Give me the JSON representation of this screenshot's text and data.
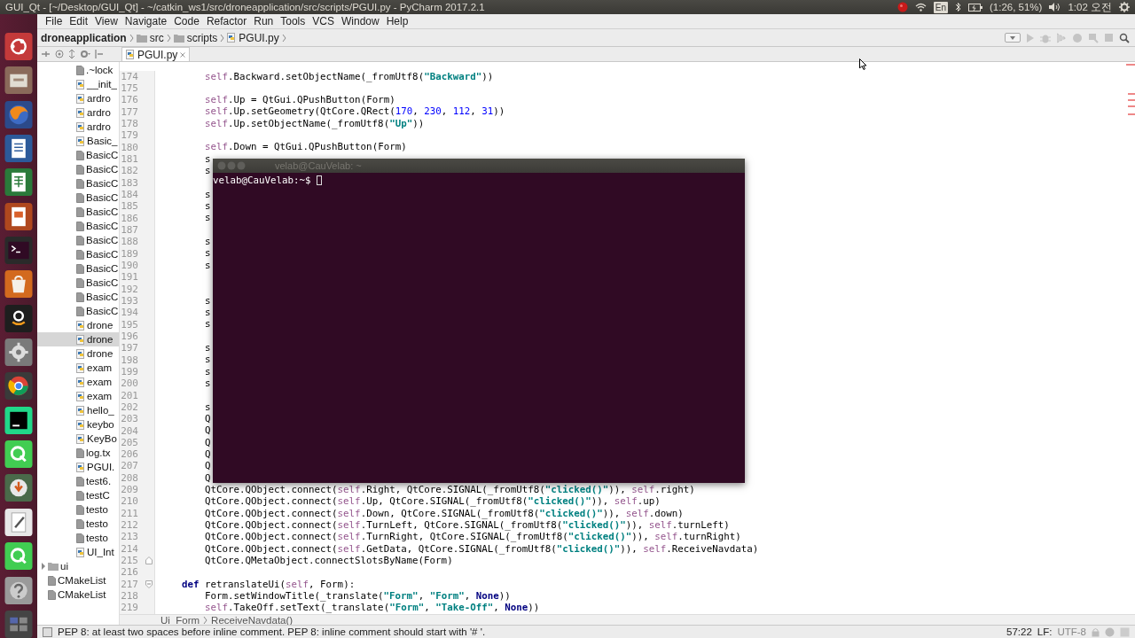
{
  "top_panel": {
    "window_title": "GUI_Qt - [~/Desktop/GUI_Qt] - ~/catkin_ws1/src/droneapplication/src/scripts/PGUI.py - PyCharm 2017.2.1",
    "keyboard": "En",
    "battery": "(1:26, 51%)",
    "clock": "1:02 오전"
  },
  "menu": [
    "File",
    "Edit",
    "View",
    "Navigate",
    "Code",
    "Refactor",
    "Run",
    "Tools",
    "VCS",
    "Window",
    "Help"
  ],
  "navigation_bar": [
    {
      "label": "droneapplication",
      "kind": "module"
    },
    {
      "label": "src",
      "kind": "folder"
    },
    {
      "label": "scripts",
      "kind": "folder"
    },
    {
      "label": "PGUI.py",
      "kind": "python"
    }
  ],
  "editor_tabs": [
    {
      "label": "PGUI.py",
      "selected": true
    }
  ],
  "project_tree": [
    {
      "kind": "group",
      "children": [
        {
          "label": ".~lock",
          "kind": "file",
          "selected": false
        },
        {
          "label": "__init_",
          "kind": "python",
          "selected": false
        },
        {
          "label": "ardro",
          "kind": "python",
          "selected": false
        },
        {
          "label": "ardro",
          "kind": "python",
          "selected": false
        },
        {
          "label": "ardro",
          "kind": "python",
          "selected": false
        },
        {
          "label": "Basic_",
          "kind": "python",
          "selected": false
        },
        {
          "label": "BasicC",
          "kind": "file",
          "selected": false
        },
        {
          "label": "BasicC",
          "kind": "file",
          "selected": false
        },
        {
          "label": "BasicC",
          "kind": "file",
          "selected": false
        },
        {
          "label": "BasicC",
          "kind": "file",
          "selected": false
        },
        {
          "label": "BasicC",
          "kind": "file",
          "selected": false
        },
        {
          "label": "BasicC",
          "kind": "file",
          "selected": false
        },
        {
          "label": "BasicC",
          "kind": "file",
          "selected": false
        },
        {
          "label": "BasicC",
          "kind": "file",
          "selected": false
        },
        {
          "label": "BasicC",
          "kind": "file",
          "selected": false
        },
        {
          "label": "BasicC",
          "kind": "file",
          "selected": false
        },
        {
          "label": "BasicC",
          "kind": "file",
          "selected": false
        },
        {
          "label": "BasicC",
          "kind": "file",
          "selected": false
        },
        {
          "label": "drone",
          "kind": "python",
          "selected": false
        },
        {
          "label": "drone",
          "kind": "python",
          "selected": true
        },
        {
          "label": "drone",
          "kind": "python",
          "selected": false
        },
        {
          "label": "exam",
          "kind": "python",
          "selected": false
        },
        {
          "label": "exam",
          "kind": "python",
          "selected": false
        },
        {
          "label": "exam",
          "kind": "python",
          "selected": false
        },
        {
          "label": "hello_",
          "kind": "python",
          "selected": false
        },
        {
          "label": "keybo",
          "kind": "python",
          "selected": false
        },
        {
          "label": "KeyBo",
          "kind": "python",
          "selected": false
        },
        {
          "label": "log.tx",
          "kind": "file",
          "selected": false
        },
        {
          "label": "PGUI.",
          "kind": "python",
          "selected": false
        },
        {
          "label": "test6.",
          "kind": "file",
          "selected": false
        },
        {
          "label": "testC",
          "kind": "file",
          "selected": false
        },
        {
          "label": "testo",
          "kind": "file",
          "selected": false
        },
        {
          "label": "testo",
          "kind": "file",
          "selected": false
        },
        {
          "label": "testo",
          "kind": "file",
          "selected": false
        },
        {
          "label": "UI_Int",
          "kind": "python",
          "selected": false
        }
      ]
    },
    {
      "label": "ui",
      "kind": "folder",
      "expanded": false,
      "selected": false
    },
    {
      "label": "CMakeList",
      "kind": "file",
      "selected": false
    },
    {
      "label": "CMakeList",
      "kind": "file",
      "selected": false
    }
  ],
  "code_lines": [
    {
      "number": "174",
      "text": "        self.Backward.setObjectName(_fromUtf8(\"Backward\"))"
    },
    {
      "number": "175"
    },
    {
      "number": "176",
      "text": "        self.Up = QtGui.QPushButton(Form)"
    },
    {
      "number": "177",
      "text": "        self.Up.setGeometry(QtCore.QRect(170, 230, 112, 31))"
    },
    {
      "number": "178",
      "text": "        self.Up.setObjectName(_fromUtf8(\"Up\"))"
    },
    {
      "number": "179"
    },
    {
      "number": "180",
      "text": "        self.Down = QtGui.QPushButton(Form)"
    },
    {
      "number": "181",
      "text": "        s"
    },
    {
      "number": "182",
      "text": "        s"
    },
    {
      "number": "183"
    },
    {
      "number": "184",
      "text": "        s"
    },
    {
      "number": "185",
      "text": "        s"
    },
    {
      "number": "186",
      "text": "        s"
    },
    {
      "number": "187"
    },
    {
      "number": "188",
      "text": "        s"
    },
    {
      "number": "189",
      "text": "        s"
    },
    {
      "number": "190",
      "text": "        s"
    },
    {
      "number": "191"
    },
    {
      "number": "192"
    },
    {
      "number": "193",
      "text": "        s"
    },
    {
      "number": "194",
      "text": "        s"
    },
    {
      "number": "195",
      "text": "        s"
    },
    {
      "number": "196"
    },
    {
      "number": "197",
      "text": "        s"
    },
    {
      "number": "198",
      "text": "        s"
    },
    {
      "number": "199",
      "text": "        s"
    },
    {
      "number": "200",
      "text": "        s"
    },
    {
      "number": "201"
    },
    {
      "number": "202",
      "text": "        s"
    },
    {
      "number": "203",
      "text": "        Q"
    },
    {
      "number": "204",
      "text": "        Q"
    },
    {
      "number": "205",
      "text": "        Q"
    },
    {
      "number": "206",
      "text": "        Q"
    },
    {
      "number": "207",
      "text": "        Q"
    },
    {
      "number": "208",
      "text": "        Q"
    },
    {
      "number": "209",
      "text": "        QtCore.QObject.connect(self.Right, QtCore.SIGNAL(_fromUtf8(\"clicked()\")), self.right)"
    },
    {
      "number": "210",
      "text": "        QtCore.QObject.connect(self.Up, QtCore.SIGNAL(_fromUtf8(\"clicked()\")), self.up)"
    },
    {
      "number": "211",
      "text": "        QtCore.QObject.connect(self.Down, QtCore.SIGNAL(_fromUtf8(\"clicked()\")), self.down)"
    },
    {
      "number": "212",
      "text": "        QtCore.QObject.connect(self.TurnLeft, QtCore.SIGNAL(_fromUtf8(\"clicked()\")), self.turnLeft)"
    },
    {
      "number": "213",
      "text": "        QtCore.QObject.connect(self.TurnRight, QtCore.SIGNAL(_fromUtf8(\"clicked()\")), self.turnRight)"
    },
    {
      "number": "214",
      "text": "        QtCore.QObject.connect(self.GetData, QtCore.SIGNAL(_fromUtf8(\"clicked()\")), self.ReceiveNavdata)"
    },
    {
      "number": "215",
      "text": "        QtCore.QMetaObject.connectSlotsByName(Form)",
      "fold_end": true
    },
    {
      "number": "216"
    },
    {
      "number": "217",
      "text": "    def retranslateUi(self, Form):",
      "fold_start": true
    },
    {
      "number": "218",
      "text": "        Form.setWindowTitle(_translate(\"Form\", \"Form\", None))"
    },
    {
      "number": "219",
      "text": "        self.TakeOff.setText(_translate(\"Form\", \"Take-Off\", None))"
    }
  ],
  "editor_breadcrumb": [
    "Ui_Form",
    "ReceiveNavdata()"
  ],
  "terminal": {
    "title": "velab@CauVelab: ~",
    "prompt": "velab@CauVelab:~$"
  },
  "status_bar": {
    "message": "PEP 8: at least two spaces before inline comment. PEP 8: inline comment should start with '# '.",
    "position": "57:22",
    "line_separator": "LF:",
    "encoding": "UTF-8"
  }
}
